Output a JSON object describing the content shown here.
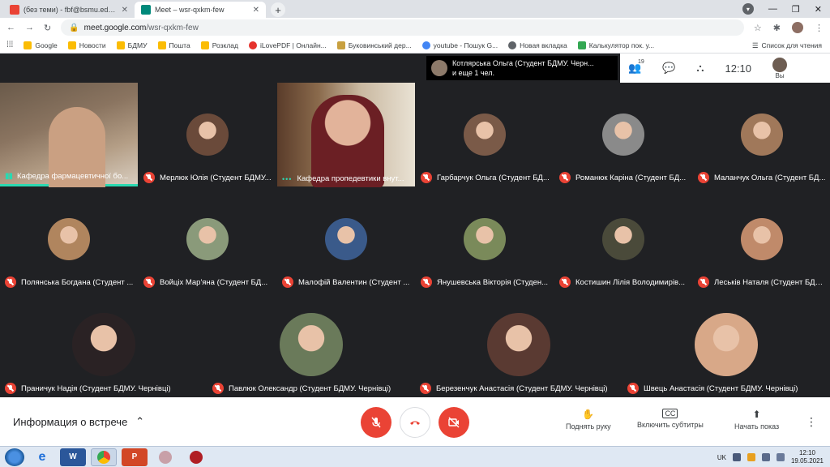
{
  "browser": {
    "tabs": [
      {
        "title": "(без теми) - fbf@bsmu.edu.ua -",
        "close": "✕",
        "favicon": "gmail-icon"
      },
      {
        "title": "Meet – wsr-qxkm-few",
        "close": "✕",
        "favicon": "meet-icon",
        "active": true
      }
    ],
    "new_tab": "+",
    "url_host": "meet.google.com",
    "url_path": "/wsr-qxkm-few",
    "bookmarks": [
      {
        "label": "Google",
        "color": "#fbbc04"
      },
      {
        "label": "Новости",
        "color": "#fbbc04"
      },
      {
        "label": "БДМУ",
        "color": "#fbbc04"
      },
      {
        "label": "Пошта",
        "color": "#fbbc04"
      },
      {
        "label": "Розклад",
        "color": "#fbbc04"
      },
      {
        "label": "iLovePDF | Онлайн...",
        "color": "#e5322d"
      },
      {
        "label": "Буковинський дер...",
        "color": "#c8a040"
      },
      {
        "label": "youtube - Пошук G...",
        "color": "#4285f4"
      },
      {
        "label": "Новая вкладка",
        "color": "#5f6368"
      },
      {
        "label": "Калькулятор пок. у...",
        "color": "#34a853"
      }
    ],
    "reading_list": "Список для чтения"
  },
  "meet": {
    "presenter_line1": "Котлярська Ольга (Студент БДМУ. Черн...",
    "presenter_line2": "и еще 1 чел.",
    "participants_count": "19",
    "clock": "12:10",
    "you_label": "Вы",
    "tiles": [
      {
        "name": "Кафедра фармацевтичної бо...",
        "kind": "video1",
        "status": "speaking"
      },
      {
        "name": "Мерлюк Юлія (Студент БДМУ...",
        "kind": "avatar",
        "status": "muted",
        "color": "#6a4a3a"
      },
      {
        "name": "Кафедра пропедевтики внут...",
        "kind": "video2",
        "status": "dots"
      },
      {
        "name": "Гарбарчук Ольга (Студент БД...",
        "kind": "avatar",
        "status": "muted",
        "color": "#7a5a48"
      },
      {
        "name": "Романюк Каріна (Студент БД...",
        "kind": "avatar",
        "status": "muted",
        "color": "#8a8a8a"
      },
      {
        "name": "Маланчук Ольга (Студент БД...",
        "kind": "avatar",
        "status": "muted",
        "color": "#a0785a"
      },
      {
        "name": "Полянська Богдана (Студент ...",
        "kind": "avatar",
        "status": "muted",
        "color": "#b0855e"
      },
      {
        "name": "Войціх Мар'яна (Студент БД...",
        "kind": "avatar",
        "status": "muted",
        "color": "#8a9a7a"
      },
      {
        "name": "Малофій Валентин (Студент ...",
        "kind": "avatar",
        "status": "muted",
        "color": "#3a5a8a"
      },
      {
        "name": "Янушевська Вікторія (Студен...",
        "kind": "avatar",
        "status": "muted",
        "color": "#7a8a5a"
      },
      {
        "name": "Костишин Лілія Володимирів...",
        "kind": "avatar",
        "status": "muted",
        "color": "#4a4a3a"
      },
      {
        "name": "Леськів Наталя (Студент БДМ...",
        "kind": "avatar",
        "status": "muted",
        "color": "#c08a6a"
      },
      {
        "name": "Праничук Надія (Студент БДМУ. Чернівці)",
        "kind": "avatar",
        "status": "muted",
        "color": "#2a2224"
      },
      {
        "name": "Павлюк Олександр (Студент БДМУ. Чернівці)",
        "kind": "avatar",
        "status": "muted",
        "color": "#6a7a5a"
      },
      {
        "name": "Березенчук Анастасія (Студент БДМУ. Чернівці)",
        "kind": "avatar",
        "status": "muted",
        "color": "#5a3a32"
      },
      {
        "name": "Швець Анастасія (Студент БДМУ. Чернівці)",
        "kind": "avatar",
        "status": "muted",
        "color": "#d8a888"
      }
    ],
    "meeting_info": "Информация о встрече",
    "raise_hand": "Поднять руку",
    "captions": "Включить субтитры",
    "present": "Начать показ"
  },
  "taskbar": {
    "lang": "UK",
    "time": "12:10",
    "date": "19.05.2021",
    "apps": [
      "start-button",
      "ie-icon",
      "word-icon",
      "chrome-icon",
      "powerpoint-icon",
      "app-icon",
      "app2-icon"
    ]
  }
}
